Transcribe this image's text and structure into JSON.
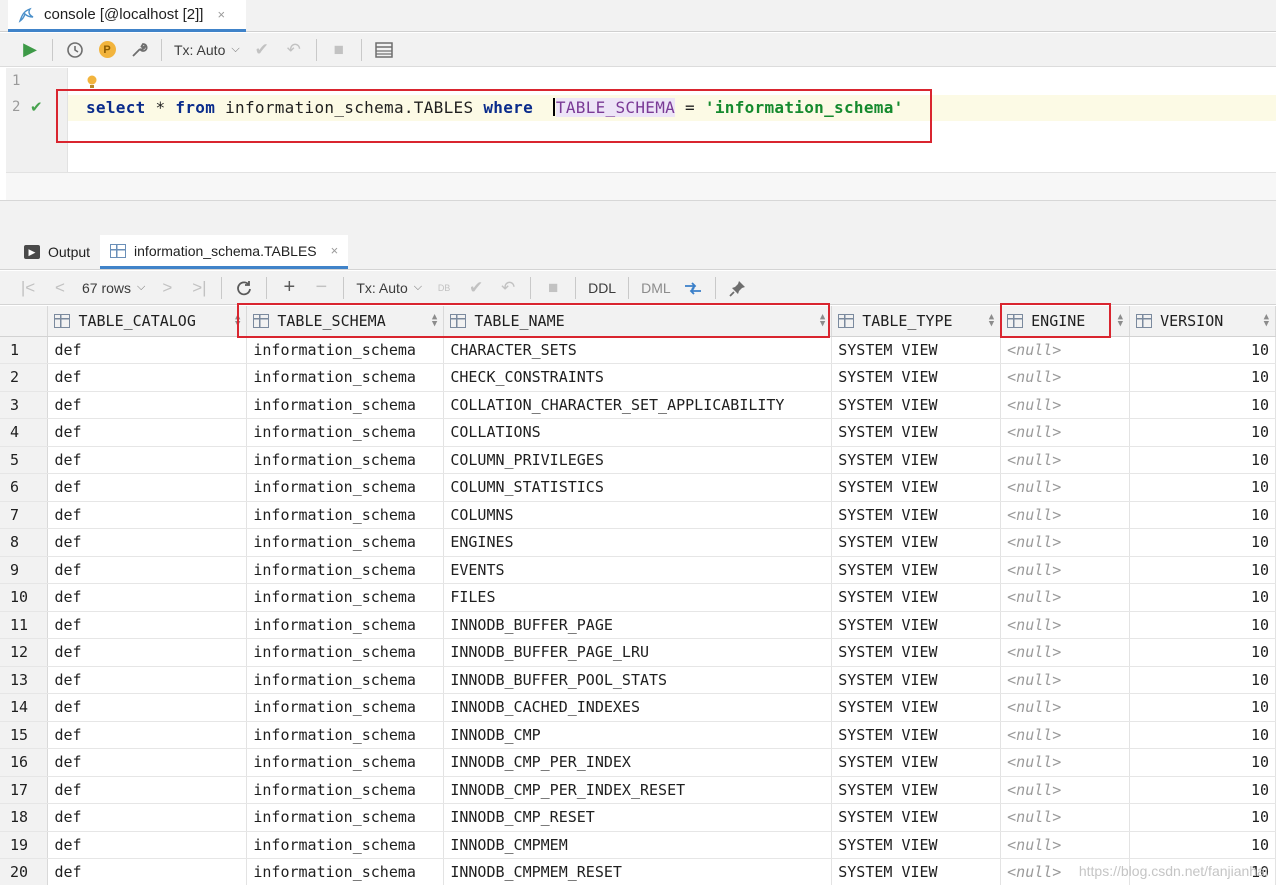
{
  "tabs": {
    "console_title": "console [@localhost [2]]",
    "close": "×"
  },
  "toolbar": {
    "tx_label": "Tx: Auto",
    "p_badge": "P"
  },
  "editor": {
    "line1": "1",
    "line2": "2",
    "sql": {
      "kw_select": "select",
      "star": " * ",
      "kw_from": "from",
      "table": " information_schema.TABLES ",
      "kw_where": "where",
      "gap": "  ",
      "column": "TABLE_SCHEMA",
      "eq": " = ",
      "string": "'information_schema'"
    }
  },
  "result_tabs": {
    "output": "Output",
    "table": "information_schema.TABLES",
    "close": "×"
  },
  "results_toolbar": {
    "rows": "67 rows",
    "tx_label": "Tx: Auto",
    "ddl": "DDL",
    "dml": "DML",
    "db_label": "DB"
  },
  "columns": [
    "TABLE_CATALOG",
    "TABLE_SCHEMA",
    "TABLE_NAME",
    "TABLE_TYPE",
    "ENGINE",
    "VERSION"
  ],
  "rows": [
    [
      "1",
      "def",
      "information_schema",
      "CHARACTER_SETS",
      "SYSTEM VIEW",
      "<null>",
      "10"
    ],
    [
      "2",
      "def",
      "information_schema",
      "CHECK_CONSTRAINTS",
      "SYSTEM VIEW",
      "<null>",
      "10"
    ],
    [
      "3",
      "def",
      "information_schema",
      "COLLATION_CHARACTER_SET_APPLICABILITY",
      "SYSTEM VIEW",
      "<null>",
      "10"
    ],
    [
      "4",
      "def",
      "information_schema",
      "COLLATIONS",
      "SYSTEM VIEW",
      "<null>",
      "10"
    ],
    [
      "5",
      "def",
      "information_schema",
      "COLUMN_PRIVILEGES",
      "SYSTEM VIEW",
      "<null>",
      "10"
    ],
    [
      "6",
      "def",
      "information_schema",
      "COLUMN_STATISTICS",
      "SYSTEM VIEW",
      "<null>",
      "10"
    ],
    [
      "7",
      "def",
      "information_schema",
      "COLUMNS",
      "SYSTEM VIEW",
      "<null>",
      "10"
    ],
    [
      "8",
      "def",
      "information_schema",
      "ENGINES",
      "SYSTEM VIEW",
      "<null>",
      "10"
    ],
    [
      "9",
      "def",
      "information_schema",
      "EVENTS",
      "SYSTEM VIEW",
      "<null>",
      "10"
    ],
    [
      "10",
      "def",
      "information_schema",
      "FILES",
      "SYSTEM VIEW",
      "<null>",
      "10"
    ],
    [
      "11",
      "def",
      "information_schema",
      "INNODB_BUFFER_PAGE",
      "SYSTEM VIEW",
      "<null>",
      "10"
    ],
    [
      "12",
      "def",
      "information_schema",
      "INNODB_BUFFER_PAGE_LRU",
      "SYSTEM VIEW",
      "<null>",
      "10"
    ],
    [
      "13",
      "def",
      "information_schema",
      "INNODB_BUFFER_POOL_STATS",
      "SYSTEM VIEW",
      "<null>",
      "10"
    ],
    [
      "14",
      "def",
      "information_schema",
      "INNODB_CACHED_INDEXES",
      "SYSTEM VIEW",
      "<null>",
      "10"
    ],
    [
      "15",
      "def",
      "information_schema",
      "INNODB_CMP",
      "SYSTEM VIEW",
      "<null>",
      "10"
    ],
    [
      "16",
      "def",
      "information_schema",
      "INNODB_CMP_PER_INDEX",
      "SYSTEM VIEW",
      "<null>",
      "10"
    ],
    [
      "17",
      "def",
      "information_schema",
      "INNODB_CMP_PER_INDEX_RESET",
      "SYSTEM VIEW",
      "<null>",
      "10"
    ],
    [
      "18",
      "def",
      "information_schema",
      "INNODB_CMP_RESET",
      "SYSTEM VIEW",
      "<null>",
      "10"
    ],
    [
      "19",
      "def",
      "information_schema",
      "INNODB_CMPMEM",
      "SYSTEM VIEW",
      "<null>",
      "10"
    ],
    [
      "20",
      "def",
      "information_schema",
      "INNODB_CMPMEM_RESET",
      "SYSTEM VIEW",
      "<null>",
      "10"
    ]
  ],
  "watermark": "https://blog.csdn.net/fanjianhai",
  "colors": {
    "accent": "#4083c9",
    "highlight_box": "#d9252f",
    "run_green": "#3d9a47",
    "keyword": "#0a2c8c",
    "string": "#158a2e"
  }
}
